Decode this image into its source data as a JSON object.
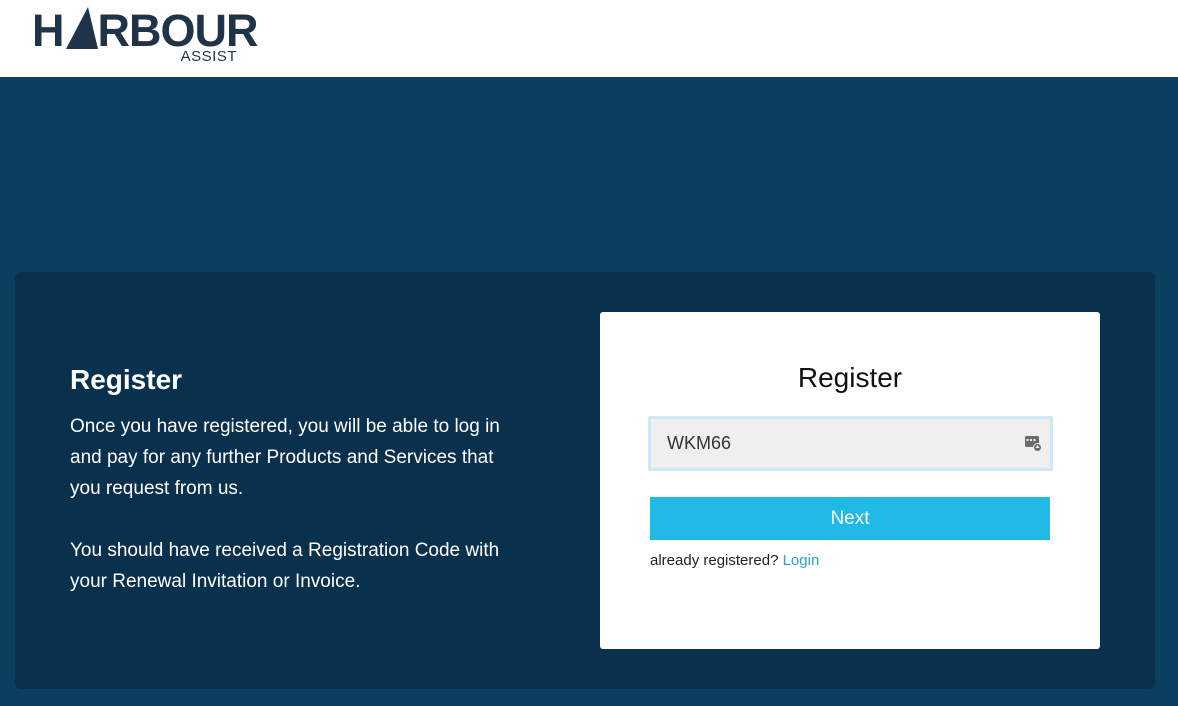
{
  "brand": {
    "logo_main_left": "H",
    "logo_main_right": "RBOUR",
    "logo_sub": "ASSIST"
  },
  "info": {
    "title": "Register",
    "paragraph_1": "Once you have registered, you will be able to log in and pay for any further Products and Services that you request from us.",
    "paragraph_2": "You should have received a Registration Code with your Renewal Invitation or Invoice."
  },
  "form": {
    "title": "Register",
    "code_value": "WKM66",
    "next_label": "Next",
    "already_registered_text": "already registered?",
    "login_link": "Login",
    "input_icon": "autofill-card-icon"
  },
  "colors": {
    "header_bg": "#ffffff",
    "hero_bg": "#0b3e5f",
    "panel_bg": "#09304c",
    "button_bg": "#21b9e6",
    "link": "#2aa0d4",
    "logo": "#1f3448"
  }
}
